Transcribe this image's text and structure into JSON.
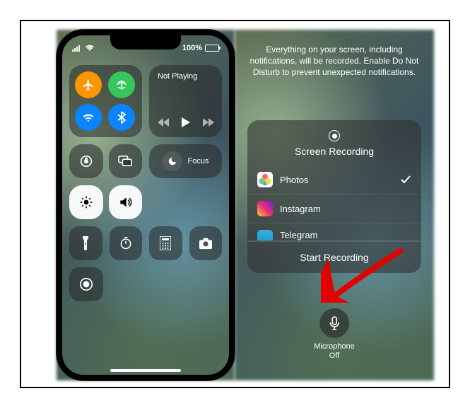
{
  "statusbar": {
    "battery_label": "100%"
  },
  "control_center": {
    "media_status": "Not Playing",
    "focus_label": "Focus"
  },
  "screen_recording": {
    "info_text": "Everything on your screen, including notifications, will be recorded. Enable Do Not Disturb to prevent unexpected notifications.",
    "title": "Screen Recording",
    "options": [
      {
        "label": "Photos",
        "selected": true
      },
      {
        "label": "Instagram",
        "selected": false
      },
      {
        "label": "Telegram",
        "selected": false
      }
    ],
    "start_button": "Start Recording",
    "microphone_label_line1": "Microphone",
    "microphone_label_line2": "Off"
  }
}
